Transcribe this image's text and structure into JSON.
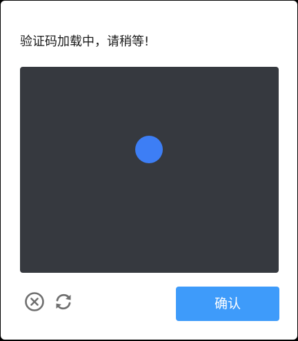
{
  "dialog": {
    "message": "验证码加载中，请稍等!",
    "confirm_label": "确认",
    "icons": {
      "close": "close-circle-icon",
      "refresh": "refresh-icon"
    },
    "colors": {
      "viewport_bg": "#36393f",
      "loading_dot": "#3d7ef5",
      "confirm_bg": "#3e9bfa",
      "icon_gray": "#6f6f6f"
    }
  }
}
